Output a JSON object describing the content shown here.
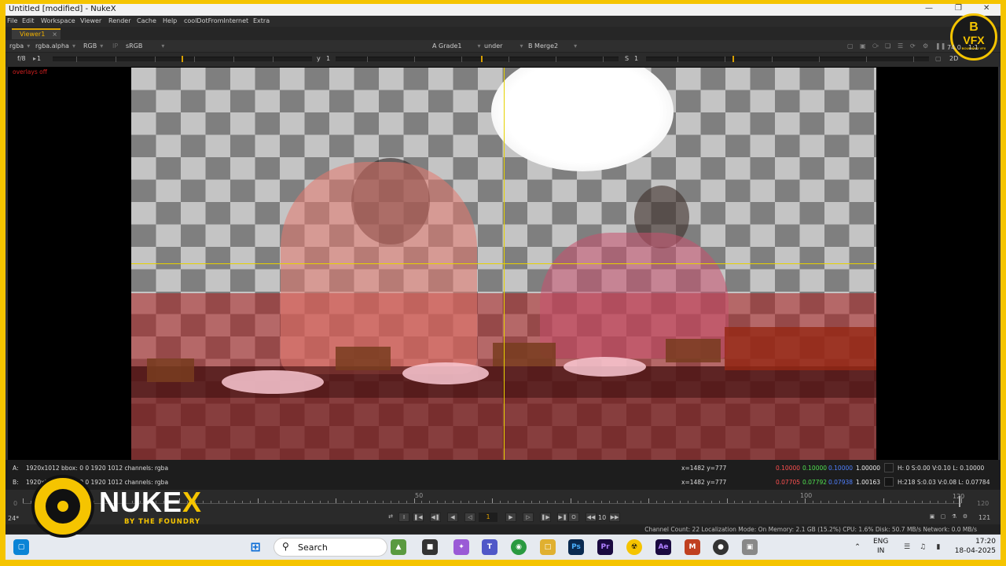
{
  "window": {
    "title": "Untitled [modified] - NukeX"
  },
  "menu": [
    "File",
    "Edit",
    "Workspace",
    "Viewer",
    "Render",
    "Cache",
    "Help",
    "coolDotFromInternet",
    "Extra"
  ],
  "tab": {
    "label": "Viewer1",
    "close": "×"
  },
  "controls": {
    "channels": "rgba",
    "alpha": "rgba.alpha",
    "color": "RGB",
    "ip": "IP",
    "lut": "sRGB",
    "a_label": "A",
    "a_input": "Grade1",
    "mode": "under",
    "b_label": "B",
    "b_input": "Merge2",
    "fstop": "f/8",
    "gain_val": "1",
    "y_label": "y",
    "gamma_val": "1",
    "s_label": "S",
    "s_val": "1",
    "zoom": "74.0",
    "ratio": "1:1",
    "view_mode": "2D",
    "overlays": "overlays off"
  },
  "info": {
    "a_line": "1920x1012  bbox: 0 0 1920 1012 channels: rgba",
    "b_line": "1920x1012  bbox: 0 0 1920 1012 channels: rgba",
    "a_label": "A:",
    "b_label": "B:",
    "a_coord": "x=1482 y=777",
    "b_coord": "x=1482 y=777",
    "a_r": "0.10000",
    "a_g": "0.10000",
    "a_b": "0.10000",
    "a_a": "1.00000",
    "b_r": "0.07705",
    "b_g": "0.07792",
    "b_b": "0.07938",
    "b_a": "1.00163",
    "a_hsv": "H:   0 S:0.00 V:0.10   L: 0.10000",
    "b_hsv": "H:218 S:0.03 V:0.08   L: 0.07784"
  },
  "timeline": {
    "start": "0",
    "mid1": "50",
    "mid2": "100",
    "end_mark": "120",
    "end": "120",
    "end2": "121",
    "fps": "24*",
    "frame": "1",
    "inc": "10"
  },
  "status": "Channel Count: 22  Localization Mode: On  Memory: 2.1 GB (15.2%)  CPU: 1.6%  Disk: 50.7 MB/s  Network: 0.0 MB/s",
  "taskbar": {
    "search_placeholder": "Search",
    "lang1": "ENG",
    "lang2": "IN",
    "time": "17:20",
    "date": "18-04-2025",
    "apps": [
      "Ps",
      "Pr",
      "Ae",
      "M"
    ]
  },
  "logo": {
    "nuke": "NUKE",
    "x": "X",
    "sub": "BY THE FOUNDRY",
    "badge_b": "B",
    "badge_vfx": "VFX",
    "badge_sub": "BOURNING VFX"
  },
  "colors": {
    "accent": "#f5c400",
    "red": "#ff5050",
    "green": "#50e050",
    "blue": "#5080ff"
  }
}
